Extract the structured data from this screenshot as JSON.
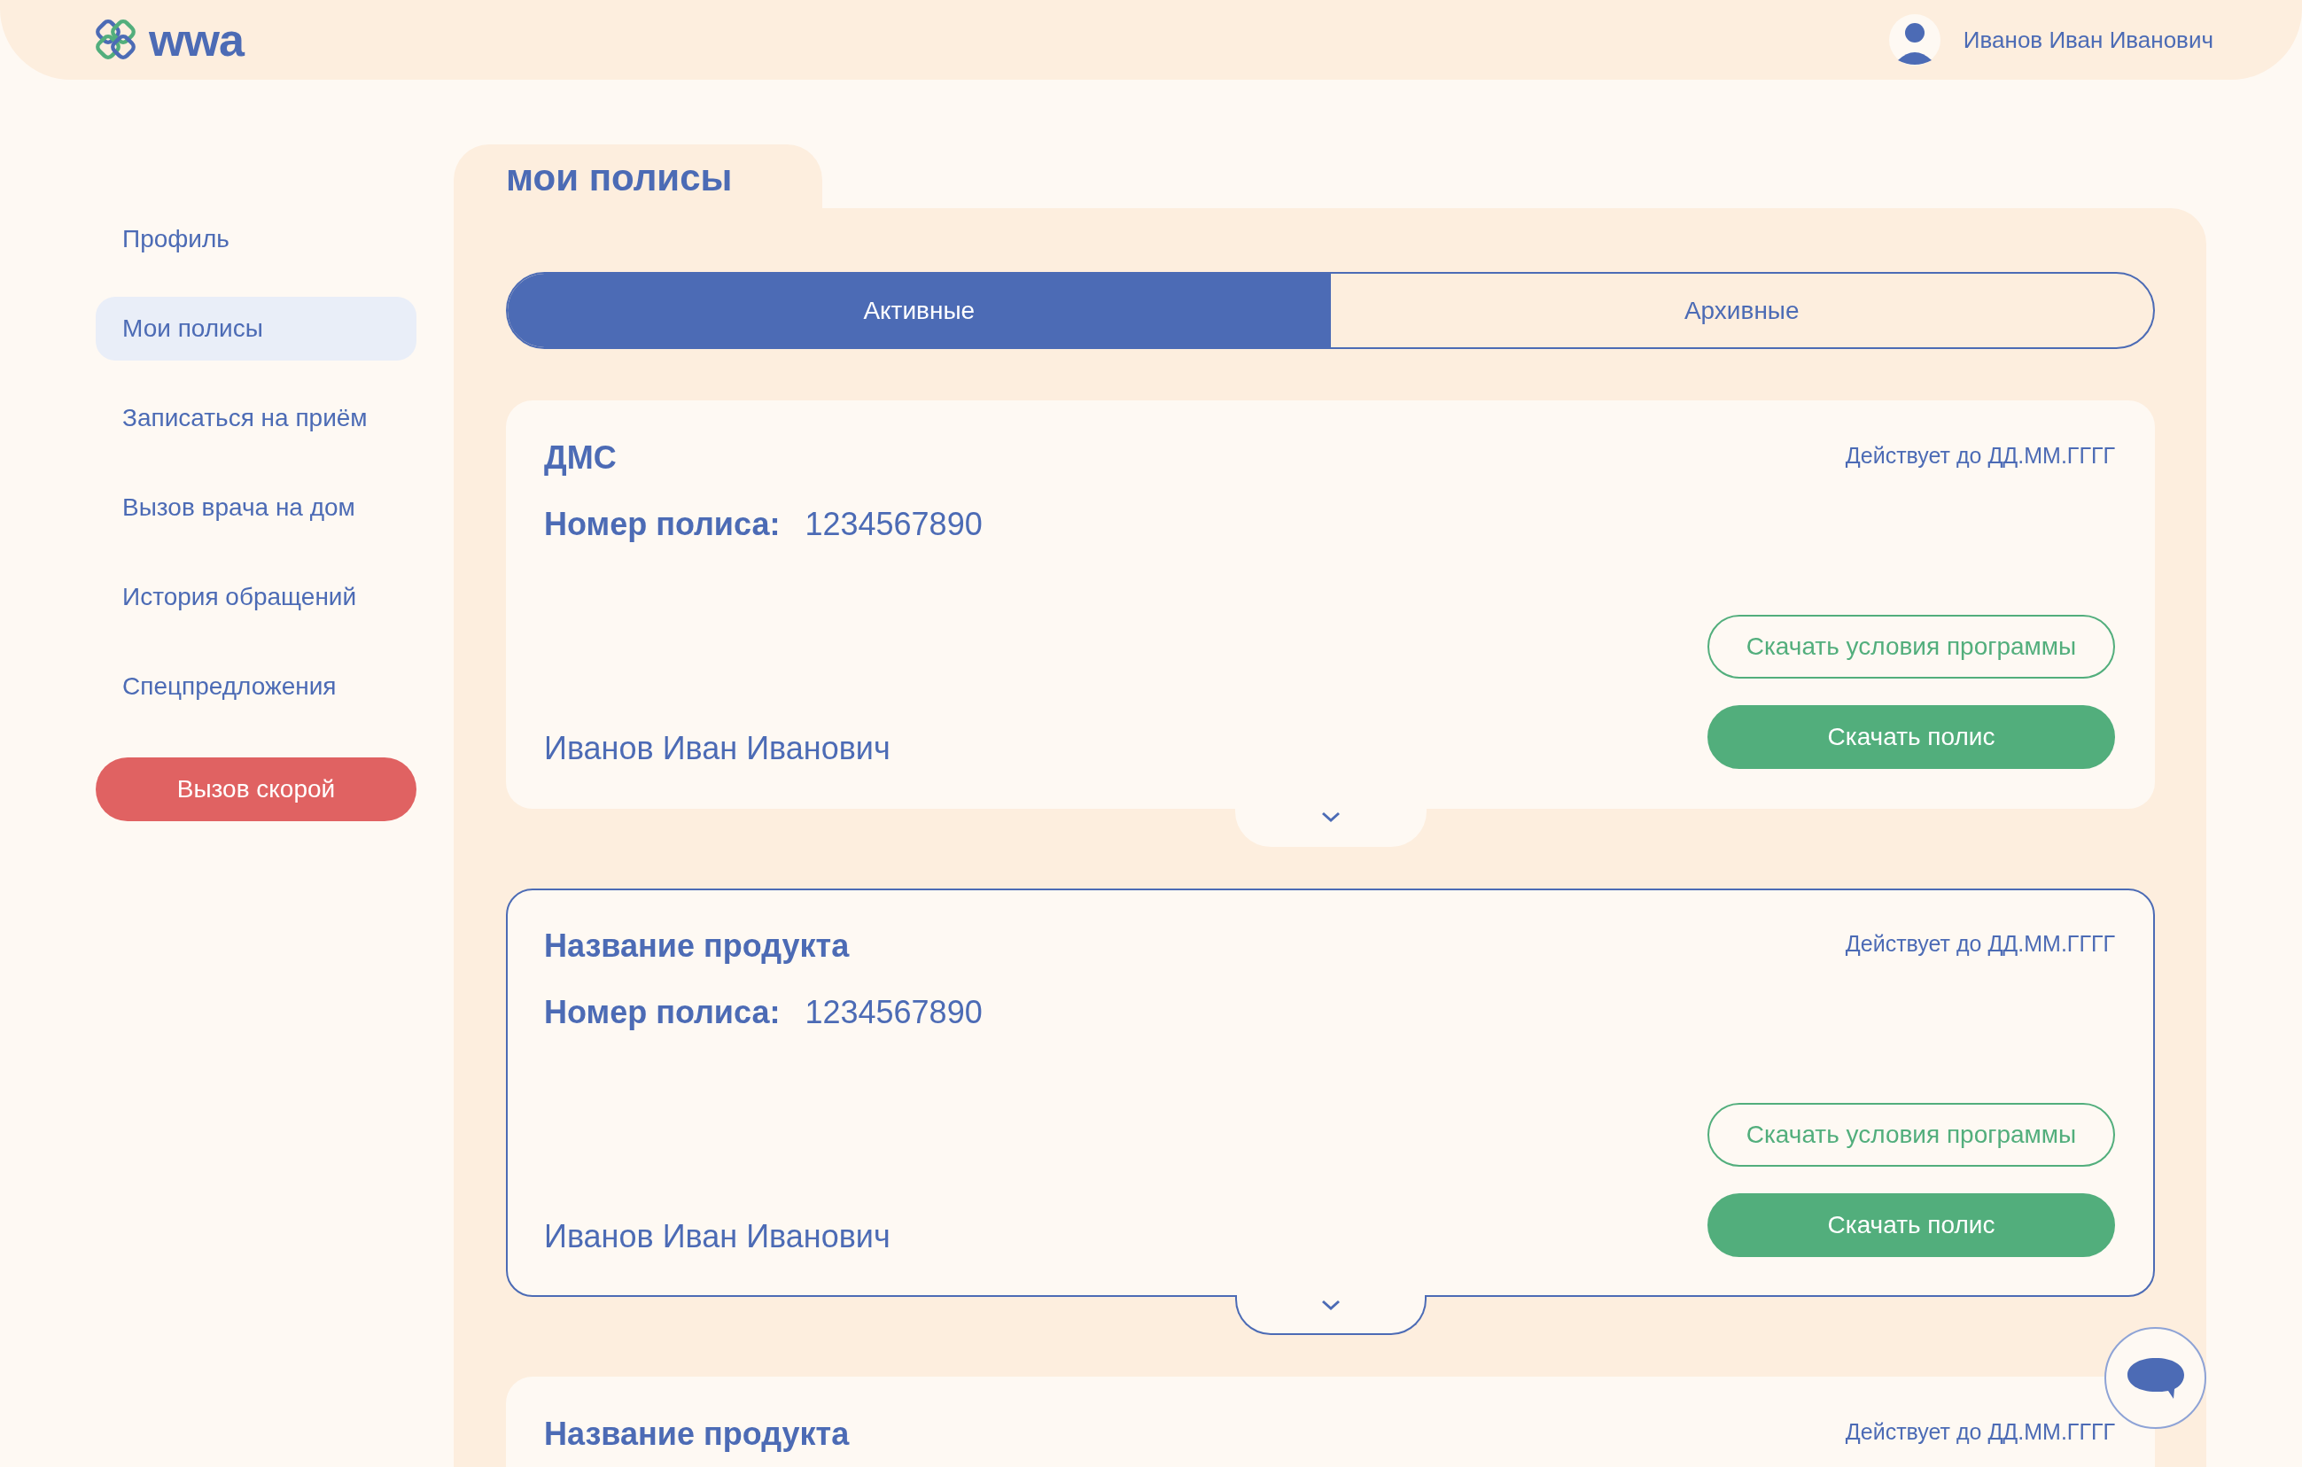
{
  "header": {
    "logo_text": "wwa",
    "user_name": "Иванов Иван Иванович"
  },
  "sidebar": {
    "items": [
      {
        "label": "Профиль",
        "selected": false
      },
      {
        "label": "Мои полисы",
        "selected": true
      },
      {
        "label": "Записаться на приём",
        "selected": false
      },
      {
        "label": "Вызов врача на дом",
        "selected": false
      },
      {
        "label": "История обращений",
        "selected": false
      },
      {
        "label": "Спецпредложения",
        "selected": false
      }
    ],
    "emergency_button": "Вызов скорой"
  },
  "page_title": "мои полисы",
  "tabs": [
    {
      "label": "Активные",
      "selected": true
    },
    {
      "label": "Архивные",
      "selected": false
    }
  ],
  "policies": [
    {
      "title": "ДМС",
      "validity": "Действует до ДД.ММ.ГГГГ",
      "number_label": "Номер полиса:",
      "number": "1234567890",
      "holder": "Иванов Иван Иванович",
      "terms_button": "Скачать условия программы",
      "download_button": "Скачать полис",
      "highlighted": false
    },
    {
      "title": "Название продукта",
      "validity": "Действует до ДД.ММ.ГГГГ",
      "number_label": "Номер полиса:",
      "number": "1234567890",
      "holder": "Иванов Иван Иванович",
      "terms_button": "Скачать условия программы",
      "download_button": "Скачать полис",
      "highlighted": true
    },
    {
      "title": "Название продукта",
      "validity": "Действует до ДД.ММ.ГГГГ",
      "highlighted": false
    }
  ]
}
